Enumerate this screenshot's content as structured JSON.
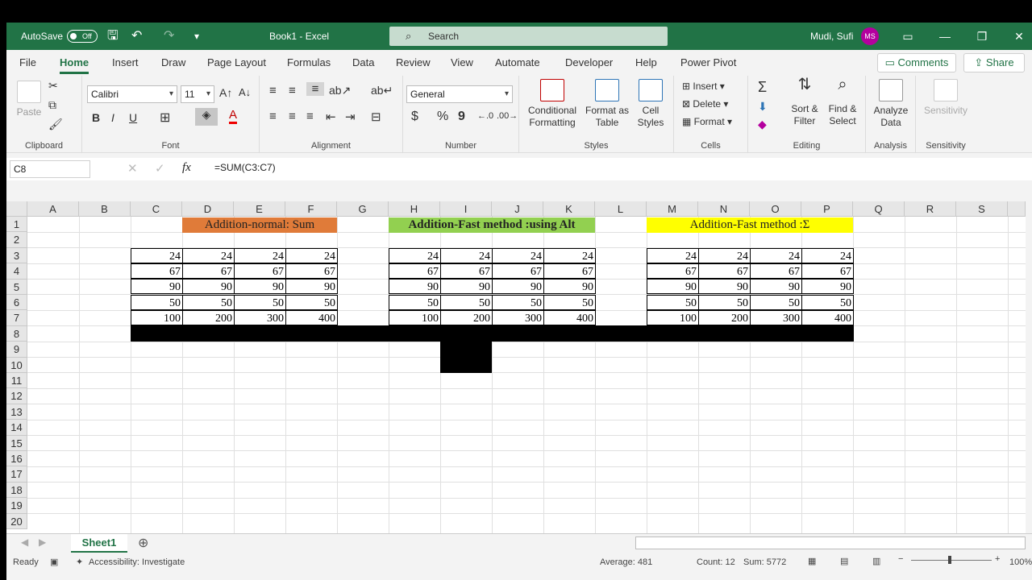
{
  "title": {
    "autosave_label": "AutoSave",
    "autosave_state": "Off",
    "doc": "Book1  -  Excel",
    "search": "Search",
    "user": "Mudi, Sufi",
    "initials": "MS"
  },
  "tabs": [
    "File",
    "Home",
    "Insert",
    "Draw",
    "Page Layout",
    "Formulas",
    "Data",
    "Review",
    "View",
    "Automate",
    "Developer",
    "Help",
    "Power Pivot"
  ],
  "actions": {
    "comments": "Comments",
    "share": "Share"
  },
  "ribbon": {
    "clipboard": {
      "paste": "Paste",
      "label": "Clipboard"
    },
    "font": {
      "name": "Calibri",
      "size": "11",
      "label": "Font",
      "bold": "B",
      "italic": "I",
      "underline": "U"
    },
    "alignment": {
      "label": "Alignment"
    },
    "number": {
      "format": "General",
      "label": "Number",
      "currency": "$",
      "percent": "%",
      "comma": "9"
    },
    "styles": {
      "cond": "Conditional Formatting",
      "table": "Format as Table",
      "cell": "Cell Styles",
      "label": "Styles"
    },
    "cells": {
      "insert": "Insert",
      "delete": "Delete",
      "format": "Format",
      "label": "Cells"
    },
    "editing": {
      "sum": "Σ",
      "sort": "Sort & Filter",
      "find": "Find & Select",
      "label": "Editing"
    },
    "analysis": {
      "analyze": "Analyze Data",
      "label": "Analysis"
    },
    "sensitivity": {
      "btn": "Sensitivity",
      "label": "Sensitivity"
    }
  },
  "formula_bar": {
    "cell": "C8",
    "formula": "=SUM(C3:C7)",
    "fx": "fx"
  },
  "columns": [
    "A",
    "B",
    "C",
    "D",
    "E",
    "F",
    "G",
    "H",
    "I",
    "J",
    "K",
    "L",
    "M",
    "N",
    "O",
    "P",
    "Q",
    "R",
    "S"
  ],
  "rows": [
    "1",
    "2",
    "3",
    "4",
    "5",
    "6",
    "7",
    "8",
    "9",
    "10",
    "11",
    "12",
    "13",
    "14",
    "15",
    "16",
    "17",
    "18",
    "19",
    "20"
  ],
  "headers": {
    "h1": "Addition-normal: Sum",
    "h2": "Addition-Fast method :using Alt",
    "h3": "Addition-Fast method :Σ"
  },
  "colors": {
    "h1": "#e07b39",
    "h2": "#92d050",
    "h3": "#ffff00",
    "accent": "#217346"
  },
  "table_values": [
    [
      "24",
      "24",
      "24",
      "24"
    ],
    [
      "67",
      "67",
      "67",
      "67"
    ],
    [
      "90",
      "90",
      "90",
      "90"
    ],
    [
      "50",
      "50",
      "50",
      "50"
    ],
    [
      "100",
      "200",
      "300",
      "400"
    ]
  ],
  "sheet": {
    "tab": "Sheet1"
  },
  "status": {
    "ready": "Ready",
    "accessibility": "Accessibility: Investigate",
    "average": "Average: 481",
    "count": "Count: 12",
    "sum": "Sum: 5772",
    "zoom": "100%"
  }
}
